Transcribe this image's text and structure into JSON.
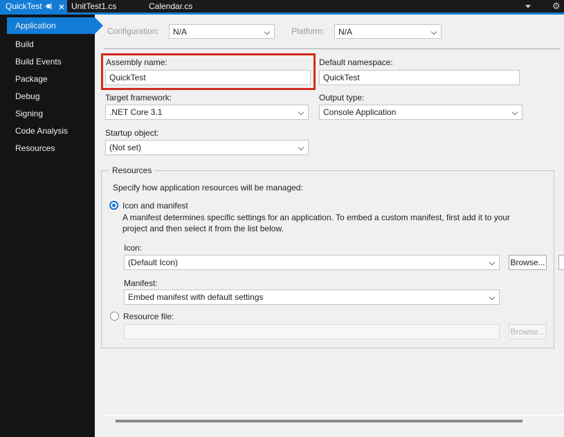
{
  "colors": {
    "accent_blue": "#127cd6",
    "highlight_red": "#d32b20",
    "tabbar_bg": "#1a1a1a",
    "sidebar_bg": "#141414",
    "content_bg": "#f0f0f0"
  },
  "tab_bar": {
    "active_tab": "QuickTest",
    "tab2": "UnitTest1.cs",
    "tab3": "Calendar.cs",
    "gear_glyph": "⚙"
  },
  "sidebar": {
    "items": [
      {
        "label": "Application",
        "selected": true
      },
      {
        "label": "Build",
        "selected": false
      },
      {
        "label": "Build Events",
        "selected": false
      },
      {
        "label": "Package",
        "selected": false
      },
      {
        "label": "Debug",
        "selected": false
      },
      {
        "label": "Signing",
        "selected": false
      },
      {
        "label": "Code Analysis",
        "selected": false
      },
      {
        "label": "Resources",
        "selected": false
      }
    ]
  },
  "main": {
    "configuration": {
      "label": "Configuration:",
      "value": "N/A",
      "disabled": true
    },
    "platform": {
      "label": "Platform:",
      "value": "N/A",
      "disabled": true
    },
    "assembly_name": {
      "label": "Assembly name:",
      "value": "QuickTest",
      "highlighted": true
    },
    "default_namespace": {
      "label": "Default namespace:",
      "value": "QuickTest"
    },
    "target_framework": {
      "label": "Target framework:",
      "value": ".NET Core 3.1"
    },
    "output_type": {
      "label": "Output type:",
      "value": "Console Application"
    },
    "startup_object": {
      "label": "Startup object:",
      "value": "(Not set)"
    },
    "resources_group": {
      "legend": "Resources",
      "intro": "Specify how application resources will be managed:",
      "icon_and_manifest_radio": {
        "label": "Icon and manifest",
        "selected": true
      },
      "manifest_description": "A manifest determines specific settings for an application. To embed a custom manifest, first add it to your project and then select it from the list below.",
      "icon_row": {
        "label": "Icon:",
        "value": "(Default Icon)",
        "browse_label": "Browse..."
      },
      "manifest_row": {
        "label": "Manifest:",
        "value": "Embed manifest with default settings"
      },
      "resource_file_radio": {
        "label": "Resource file:",
        "selected": false
      },
      "resource_file_row": {
        "value": "",
        "browse_label": "Browse...",
        "disabled": true
      }
    }
  }
}
